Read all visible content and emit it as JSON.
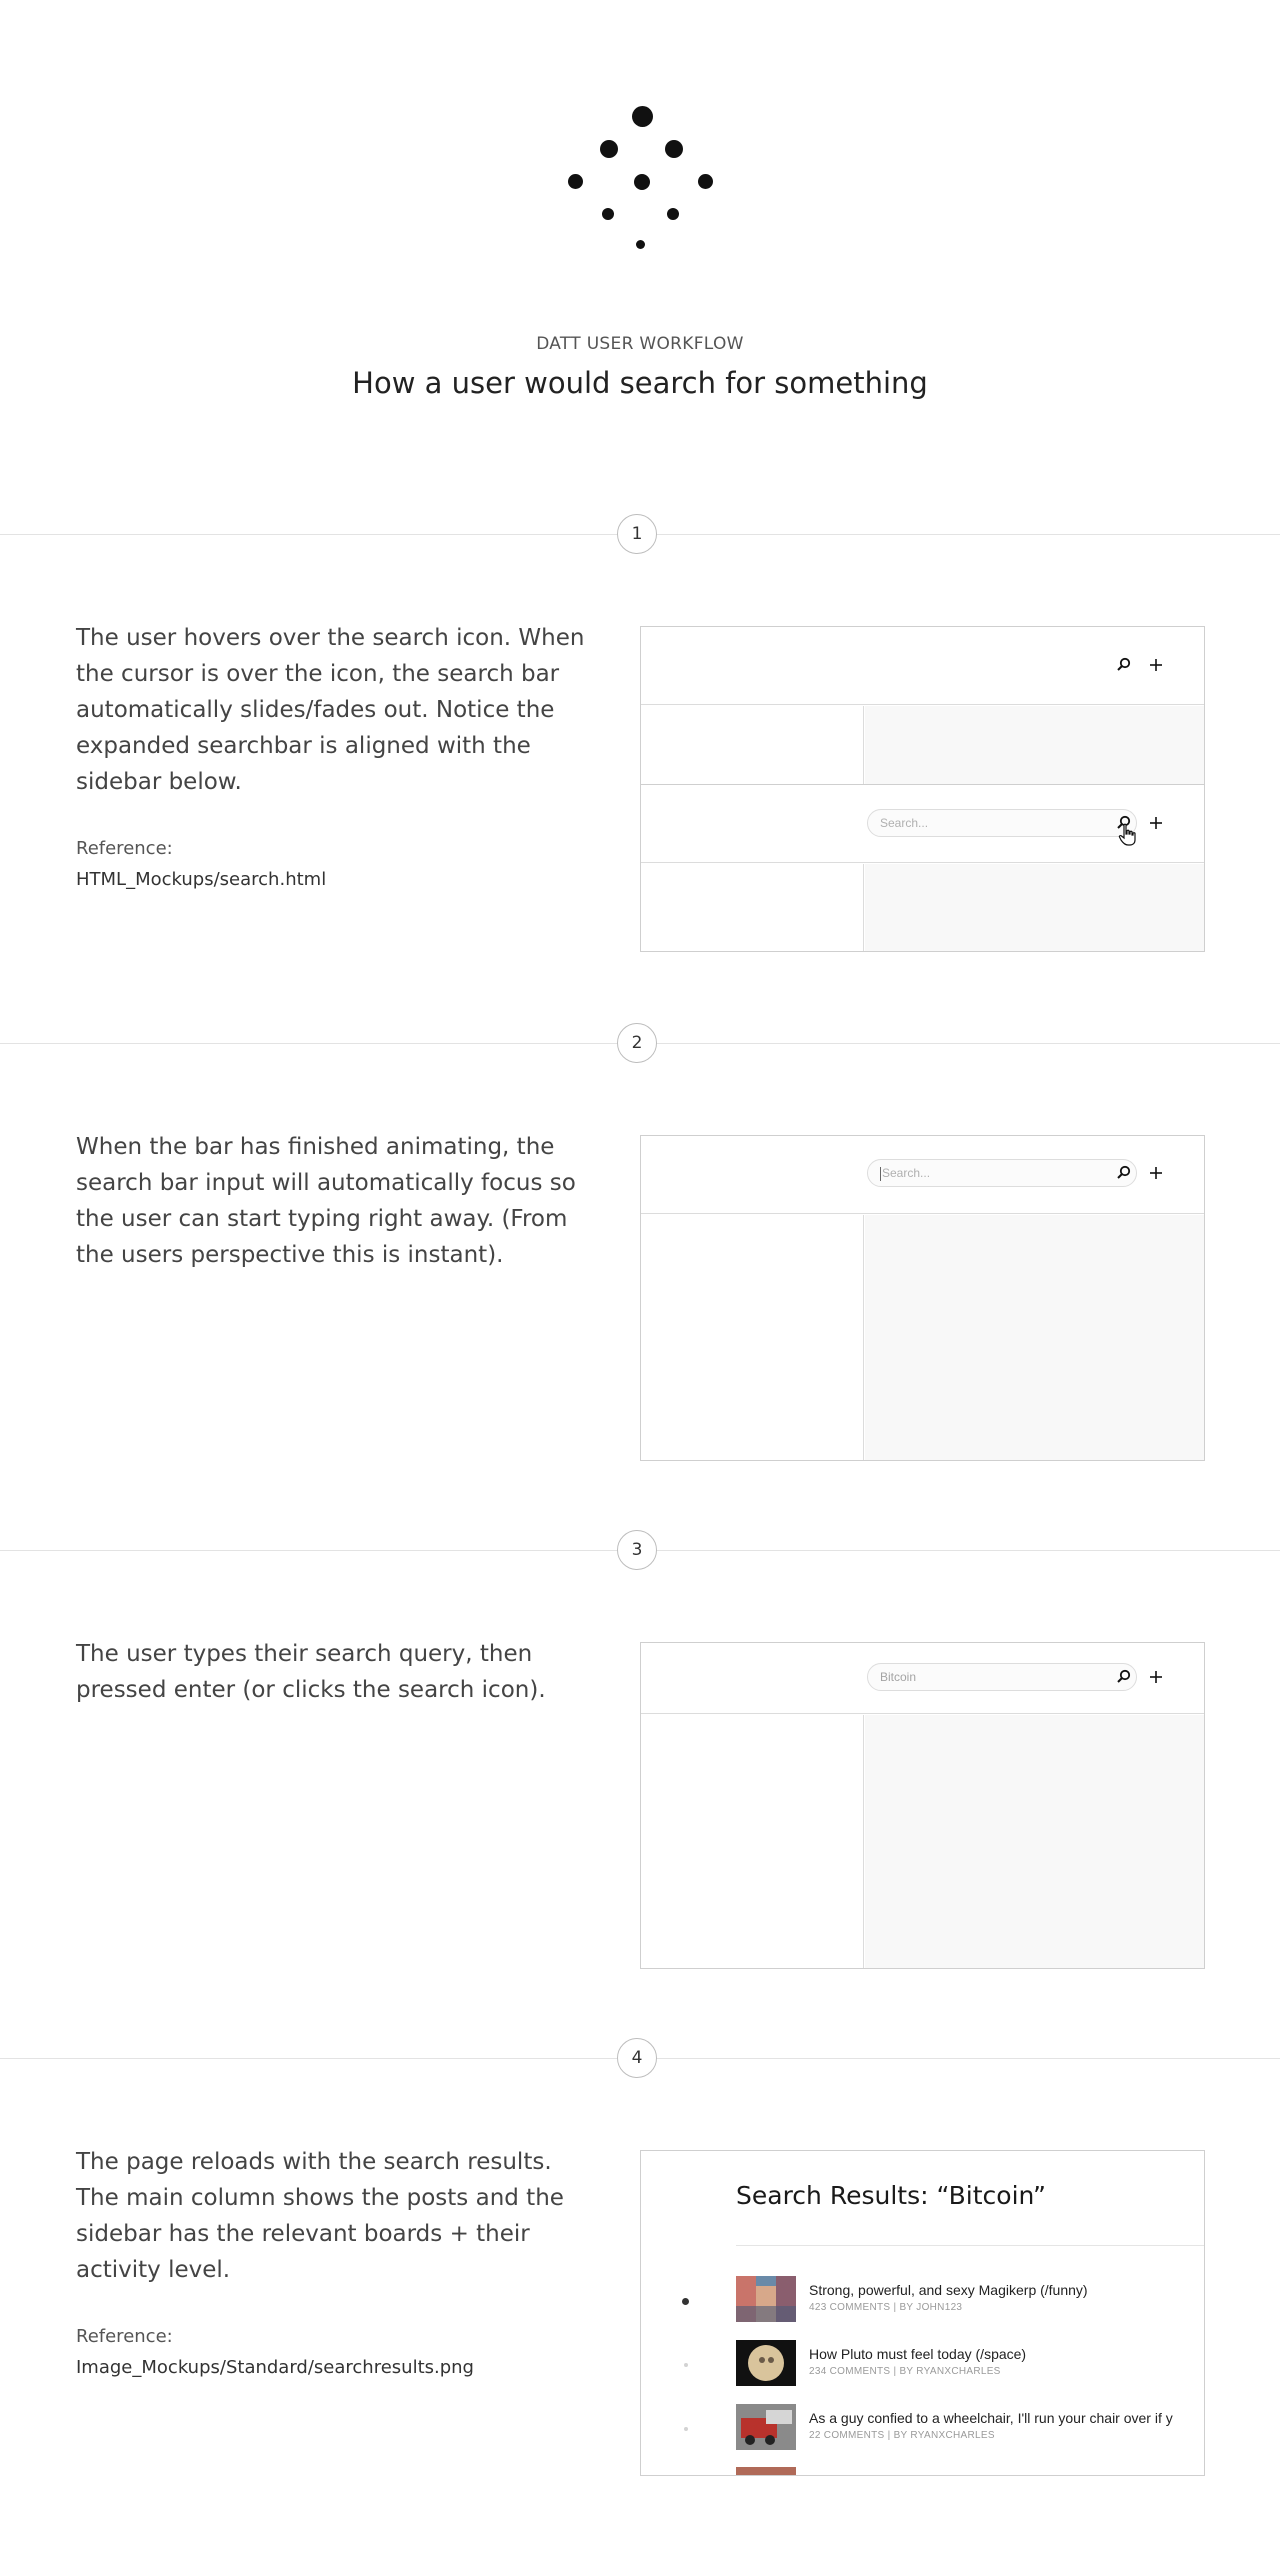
{
  "header": {
    "eyebrow": "DATT USER WORKFLOW",
    "title": "How a user would search for something"
  },
  "steps": [
    {
      "number": "1",
      "description": "The user hovers over the search icon. When the cursor is over the icon, the search bar automatically slides/fades out. Notice the expanded searchbar is aligned with the sidebar below.",
      "reference_label": "Reference:",
      "reference_path": "HTML_Mockups/search.html",
      "search_placeholder": "Search..."
    },
    {
      "number": "2",
      "description": "When the bar has finished animating, the search bar input will automatically focus so the user can start typing right away. (From the users perspective this is instant).",
      "search_placeholder": "Search..."
    },
    {
      "number": "3",
      "description": "The user types their search query, then pressed enter (or clicks the search icon).",
      "search_value": "Bitcoin"
    },
    {
      "number": "4",
      "description": "The page reloads with the search results. The main column shows the posts and the sidebar has the relevant boards + their activity level.",
      "reference_label": "Reference:",
      "reference_path": "Image_Mockups/Standard/searchresults.png",
      "results_title": "Search Results: “Bitcoin”",
      "results": [
        {
          "title": "Strong, powerful, and sexy Magikerp (/funny)",
          "meta": "423 COMMENTS | BY JOHN123"
        },
        {
          "title": "How Pluto must feel today (/space)",
          "meta": "234 COMMENTS | BY RYANXCHARLES"
        },
        {
          "title": "As a guy confied to a wheelchair, I'll run your chair over if y",
          "meta": "22 COMMENTS | BY RYANXCHARLES"
        }
      ]
    }
  ],
  "icons": {
    "search": "search-icon",
    "add": "plus-icon",
    "cursor": "pointer-hand-icon",
    "logo": "datt-dots-logo"
  },
  "colors": {
    "accent": "#111111",
    "divider": "#e3e3e3",
    "mock_main": "#f8f8f8"
  }
}
